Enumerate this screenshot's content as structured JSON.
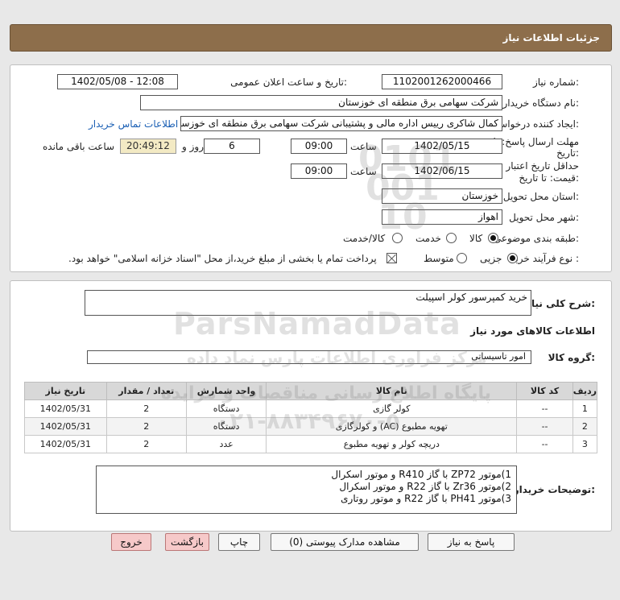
{
  "header": {
    "title": "جزئیات اطلاعات نیاز"
  },
  "form": {
    "need_number_label": "شماره نیاز:",
    "need_number": "1102001262000466",
    "announce_label": "تاریخ و ساعت اعلان عمومی:",
    "announce_value": "1402/05/08 - 12:08",
    "buyer_org_label": "نام دستگاه خریدار:",
    "buyer_org": "شرکت سهامی برق منطقه ای خوزستان",
    "requester_label": "ایجاد کننده درخواست:",
    "requester": "کمال شاکری رییس اداره مالی و پشتیبانی شرکت سهامی برق منطقه ای خوزستان",
    "contact_link": "اطلاعات تماس خریدار",
    "deadline_label_1": "مهلت ارسال پاسخ: تا",
    "deadline_label_2": "تاریخ:",
    "deadline_date": "1402/05/15",
    "time_label": "ساعت",
    "deadline_time": "09:00",
    "days_value": "6",
    "days_and_label": "روز و",
    "remaining_time": "20:49:12",
    "remaining_label": "ساعت باقی مانده",
    "validity_label_1": "حداقل تاریخ اعتبار",
    "validity_label_2": "قیمت: تا تاریخ:",
    "validity_date": "1402/06/15",
    "validity_time_label": "ساعت",
    "validity_time": "09:00",
    "province_label": "استان محل تحویل:",
    "province": "خوزستان",
    "city_label": "شهر محل تحویل:",
    "city": "اهواز",
    "category_label": "طبقه بندی موضوعی:",
    "category_options": [
      "کالا",
      "خدمت",
      "کالا/خدمت"
    ],
    "purchase_type_label": "نوع فرآیند خرید :",
    "purchase_options": [
      "جزیی",
      "متوسط"
    ],
    "purchase_note": "پرداخت تمام یا بخشی از مبلغ خرید،از محل \"اسناد خزانه اسلامی\" خواهد بود."
  },
  "details": {
    "summary_label": "شرح کلی نیاز:",
    "summary": "خرید کمپرسور کولر اسپیلت",
    "goods_info_title": "اطلاعات کالاهای مورد نیاز",
    "goods_group_label": "گروه کالا:",
    "goods_group": "امور تاسیساتی",
    "table": {
      "headers": [
        "ردیف",
        "کد کالا",
        "نام کالا",
        "واحد شمارش",
        "تعداد / مقدار",
        "تاریخ نیاز"
      ],
      "rows": [
        [
          "1",
          "--",
          "کولر گازی",
          "دستگاه",
          "2",
          "1402/05/31"
        ],
        [
          "2",
          "--",
          "تهویه مطبوع (AC) و کولرگازی",
          "دستگاه",
          "2",
          "1402/05/31"
        ],
        [
          "3",
          "--",
          "دریچه کولر و تهویه مطبوع",
          "عدد",
          "2",
          "1402/05/31"
        ]
      ]
    },
    "buyer_desc_label": "توضیحات خریدار:",
    "buyer_desc_lines": [
      "1)موتور ZP72 با گاز R410 و موتور اسکرال",
      "2)موتور Zr36 با گاز R22 و موتور اسکرال",
      "3)موتور PH41 با گاز R22 و موتور روتاری"
    ]
  },
  "buttons": {
    "reply": "پاسخ به نیاز",
    "attachments": "مشاهده مدارک پیوستی (0)",
    "print": "چاپ",
    "back": "بازگشت",
    "exit": "خروج"
  },
  "watermark": {
    "brand": "ParsNamadData",
    "line1": "مرکز فراوری اطلاعات پارس نماد داده",
    "line2": "پایگاه اطلاع رسانی مناقصات و مزایده",
    "phone": "۰۲۱-۸۸۳۴۹۶۷۰-۵",
    "digits": "0101 001 10"
  },
  "colors": {
    "header_bg": "#8d6e4b",
    "link": "#1a5fb4",
    "exit_button": "#f6c9c9",
    "remaining_bg": "#f3eac4"
  }
}
